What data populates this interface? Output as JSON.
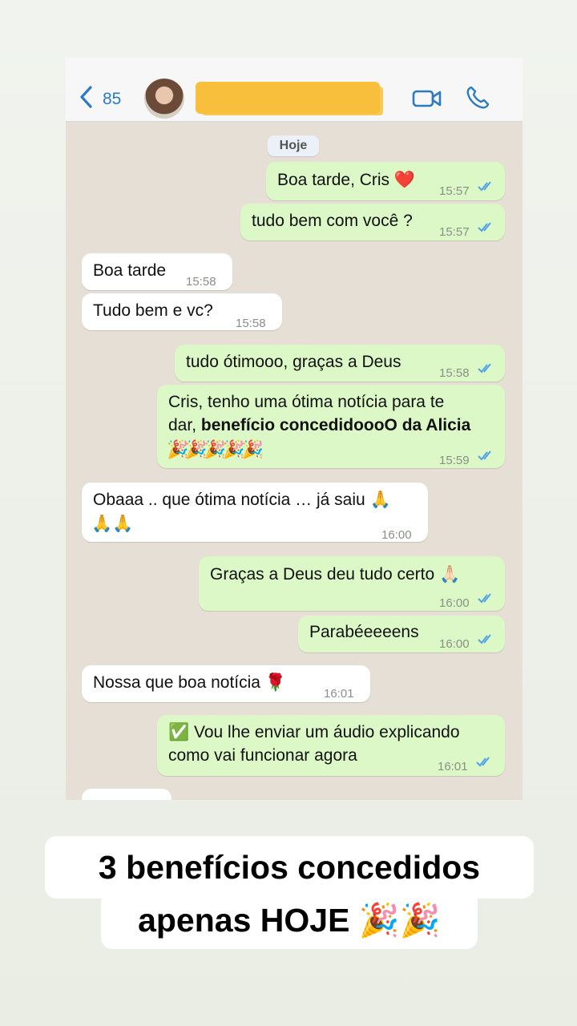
{
  "header": {
    "back_count": "85",
    "icons": [
      "back-chevron-icon",
      "video-call-icon",
      "phone-call-icon"
    ]
  },
  "chat": {
    "date_label": "Hoje",
    "messages": [
      {
        "side": "out",
        "text": "Boa tarde, Cris ❤️",
        "time": "15:57",
        "read": true
      },
      {
        "side": "out",
        "text": "tudo bem com você ?",
        "time": "15:57",
        "read": true
      },
      {
        "side": "in",
        "text": "Boa tarde",
        "time": "15:58"
      },
      {
        "side": "in",
        "text": "Tudo bem e vc?",
        "time": "15:58"
      },
      {
        "side": "out",
        "text": "tudo ótimooo, graças a Deus",
        "time": "15:58",
        "read": true
      },
      {
        "side": "out",
        "line1": "Cris, tenho uma ótima notícia para te",
        "line2_plain": "dar, ",
        "line2_bold": "benefício concedidoooO da Alicia",
        "line3": "🎉🎉🎉🎉🎉",
        "time": "15:59",
        "read": true
      },
      {
        "side": "in",
        "line1": "Obaaa .. que ótima notícia … já saiu 🙏",
        "line2": "🙏🙏",
        "time": "16:00"
      },
      {
        "side": "out",
        "text": "Graças a Deus deu tudo certo 🙏🏻",
        "time": "16:00",
        "read": true
      },
      {
        "side": "out",
        "text": "Parabéeeeens",
        "time": "16:00",
        "read": true
      },
      {
        "side": "in",
        "text": "Nossa que boa notícia 🌹",
        "time": "16:01"
      },
      {
        "side": "out",
        "line1": "✅ Vou lhe enviar um áudio explicando",
        "line2": "como vai funcionar agora",
        "time": "16:01",
        "read": true
      }
    ]
  },
  "caption": {
    "line1": "3 benefícios concedidos",
    "line2": "apenas HOJE 🎉🎉"
  },
  "colors": {
    "outgoing_bubble": "#dcf8c6",
    "incoming_bubble": "#ffffff",
    "chat_background": "#e6dfd5",
    "accent_blue": "#2a7bc4",
    "redaction": "#f7b928"
  }
}
